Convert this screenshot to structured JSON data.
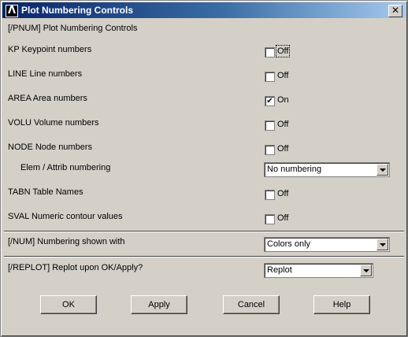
{
  "window": {
    "title": "Plot Numbering Controls",
    "close_symbol": "✕",
    "app_icon_glyph": "Λ"
  },
  "header": "[/PNUM]  Plot Numbering Controls",
  "rows": [
    {
      "label": "KP    Keypoint numbers",
      "state": "Off",
      "checked": false
    },
    {
      "label": "LINE  Line numbers",
      "state": "Off",
      "checked": false
    },
    {
      "label": "AREA  Area numbers",
      "state": "On",
      "checked": true
    },
    {
      "label": "VOLU  Volume numbers",
      "state": "Off",
      "checked": false
    },
    {
      "label": "NODE  Node numbers",
      "state": "Off",
      "checked": false
    },
    {
      "label": "TABN  Table Names",
      "state": "Off",
      "checked": false
    },
    {
      "label": "SVAL  Numeric contour values",
      "state": "Off",
      "checked": false
    }
  ],
  "elem_attrib": {
    "label": "Elem / Attrib numbering",
    "value": "No numbering"
  },
  "num": {
    "label": "[/NUM]  Numbering shown with",
    "value": "Colors only"
  },
  "replot": {
    "label": "[/REPLOT]  Replot upon OK/Apply?",
    "value": "Replot"
  },
  "buttons": {
    "ok": "OK",
    "apply": "Apply",
    "cancel": "Cancel",
    "help": "Help"
  },
  "check_mark": "✔",
  "colors": {
    "titlebar_start": "#0a246a",
    "titlebar_end": "#a6caf0",
    "face": "#d4d0c8"
  }
}
